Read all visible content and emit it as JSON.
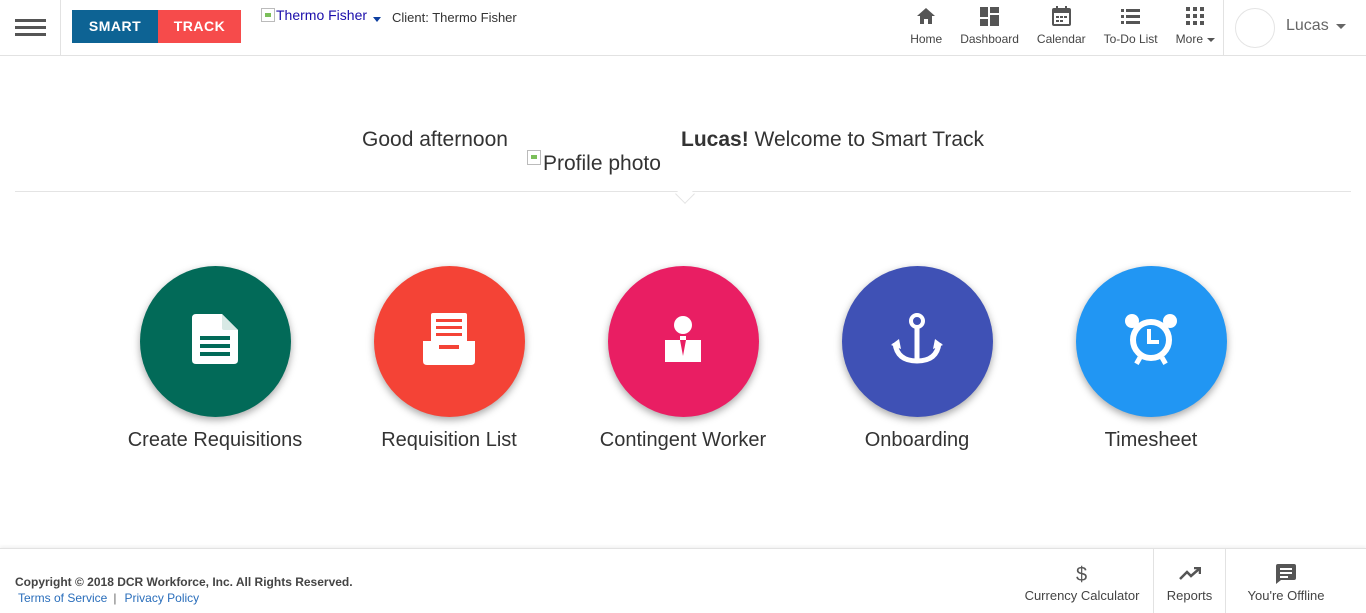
{
  "header": {
    "logo_left": "SMART",
    "logo_right": "TRACK",
    "client_logo_alt": "Thermo Fisher",
    "client_label": "Client: Thermo Fisher",
    "nav": [
      {
        "label": "Home",
        "icon": "home-icon"
      },
      {
        "label": "Dashboard",
        "icon": "dashboard-icon"
      },
      {
        "label": "Calendar",
        "icon": "calendar-icon"
      },
      {
        "label": "To-Do List",
        "icon": "list-icon"
      },
      {
        "label": "More",
        "icon": "apps-grid-icon"
      }
    ],
    "user_name": "Lucas"
  },
  "greeting": {
    "prefix": "Good afternoon",
    "profile_photo_alt": "Profile photo",
    "name": "Lucas!",
    "suffix": " Welcome to Smart Track"
  },
  "tiles": [
    {
      "label": "Create Requisitions",
      "color": "#026a58",
      "icon": "document-icon"
    },
    {
      "label": "Requisition List",
      "color": "#f44336",
      "icon": "file-drawer-icon"
    },
    {
      "label": "Contingent Worker",
      "color": "#e91e63",
      "icon": "worker-icon"
    },
    {
      "label": "Onboarding",
      "color": "#3f51b5",
      "icon": "anchor-icon"
    },
    {
      "label": "Timesheet",
      "color": "#2196f3",
      "icon": "alarm-clock-icon"
    }
  ],
  "footer": {
    "copyright": "Copyright © 2018 DCR Workforce, Inc. All Rights Reserved.",
    "terms": "Terms of Service",
    "separator": "|",
    "privacy": "Privacy Policy",
    "buttons": [
      {
        "label": "Currency Calculator",
        "icon": "dollar-icon"
      },
      {
        "label": "Reports",
        "icon": "trending-up-icon"
      },
      {
        "label": "You're Offline",
        "icon": "chat-icon"
      }
    ]
  }
}
